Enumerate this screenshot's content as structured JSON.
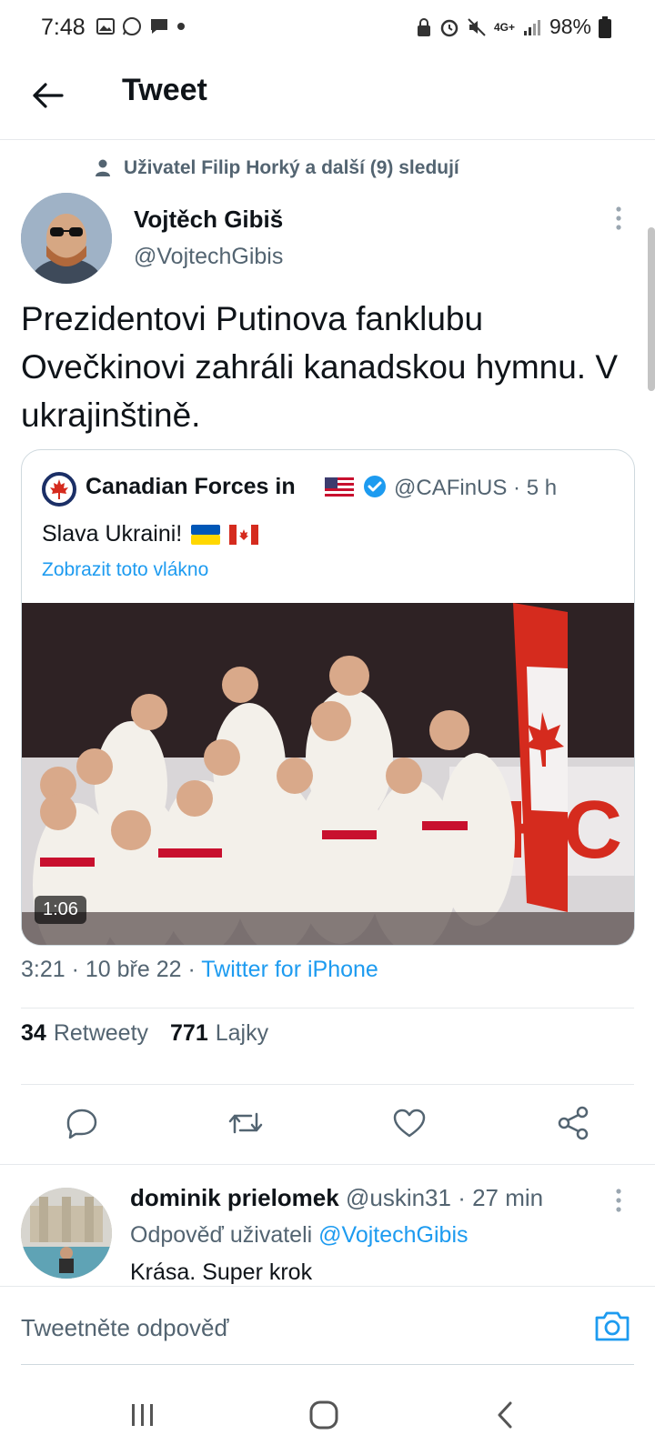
{
  "status_bar": {
    "time": "7:48",
    "battery": "98%",
    "network": "4G+"
  },
  "header": {
    "title": "Tweet"
  },
  "social_context": "Uživatel Filip Horký a další (9) sledují",
  "author": {
    "name": "Vojtěch Gibiš",
    "handle": "@VojtechGibis"
  },
  "tweet_text": "Prezidentovi Putinova fanklubu Ovečkinovi zahráli kanadskou hymnu. V ukrajinštině.",
  "quote": {
    "name": "Canadian Forces in",
    "handle_time": "@CAFinUS · 5 h",
    "text": "Slava Ukraini!",
    "show_thread": "Zobrazit toto vlákno",
    "video_duration": "1:06"
  },
  "meta": {
    "time_date": "3:21 · 10 bře 22 · ",
    "source": "Twitter for iPhone"
  },
  "stats": {
    "retweets_count": "34",
    "retweets_label": "Retweety",
    "likes_count": "771",
    "likes_label": "Lajky"
  },
  "reply": {
    "name": "dominik prielomek",
    "handle_time": "@uskin31 · 27 min",
    "replying_prefix": "Odpověď uživateli ",
    "replying_handle": "@VojtechGibis",
    "text": "Krása. Super krok"
  },
  "composer": {
    "placeholder": "Tweetněte odpověď"
  },
  "colors": {
    "accent": "#1d9bf0",
    "text": "#0f1419",
    "secondary": "#536471"
  }
}
